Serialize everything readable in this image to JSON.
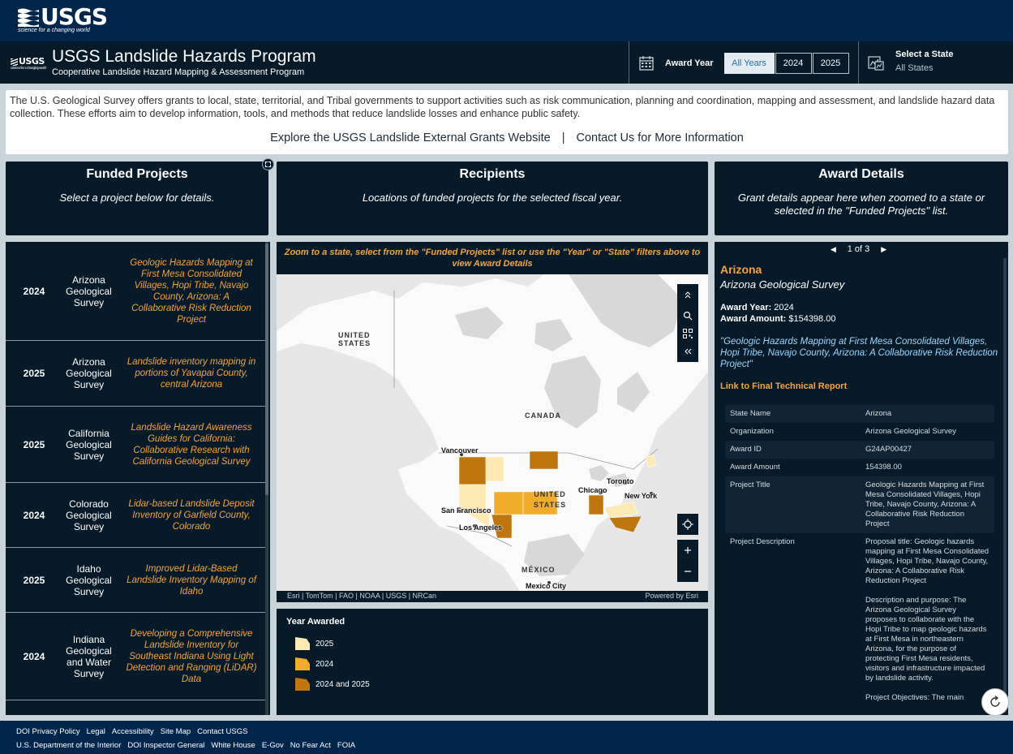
{
  "usgs_bar": {
    "logo_text": "USGS",
    "tagline": "science for a changing world"
  },
  "header": {
    "small_logo": "USGS",
    "small_tagline": "science for a changing world",
    "title": "USGS Landslide Hazards Program",
    "subtitle": "Cooperative Landslide Hazard Mapping & Assessment Program",
    "award_year_label": "Award Year",
    "year_buttons": [
      "All Years",
      "2024",
      "2025"
    ],
    "selected_year": "All Years",
    "state_label": "Select a State",
    "state_value": "All States"
  },
  "intro": {
    "text": "The U.S. Geological Survey offers grants to local, state, territorial, and Tribal governments to support activities such as risk communication, planning and coordination, mapping and assessment, and landslide hazard data collection. These efforts aim to develop information, tools, and methods that reduce landslide losses and enhance public safety.",
    "link1": "Explore the USGS Landslide External Grants Website",
    "separator": "|",
    "link2": "Contact Us for More Information"
  },
  "panels": {
    "funded": {
      "title": "Funded Projects",
      "desc": "Select a project below for details."
    },
    "recipients": {
      "title": "Recipients",
      "desc": "Locations of funded projects for the selected fiscal year."
    },
    "award": {
      "title": "Award Details",
      "desc": "Grant details appear here when zoomed to a state or selected in the \"Funded Projects\" list."
    }
  },
  "projects": [
    {
      "year": "2024",
      "org": "Arizona Geological Survey",
      "title": "Geologic Hazards Mapping at First Mesa Consolidated Villages, Hopi Tribe, Navajo County, Arizona: A Collaborative Risk Reduction Project"
    },
    {
      "year": "2025",
      "org": "Arizona Geological Survey",
      "title": "Landslide inventory mapping in portions of Yavapai County, central Arizona"
    },
    {
      "year": "2025",
      "org": "California Geological Survey",
      "title": "Landslide Hazard Awareness Guides for California: Collaborative Research with California Geological Survey"
    },
    {
      "year": "2024",
      "org": "Colorado Geological Survey",
      "title": "Lidar-based Landslide Deposit Inventory of Garfield County, Colorado"
    },
    {
      "year": "2025",
      "org": "Idaho Geological Survey",
      "title": "Improved Lidar-Based Landslide Inventory Mapping of Idaho"
    },
    {
      "year": "2024",
      "org": "Indiana Geological and Water Survey",
      "title": "Developing a Comprehensive Landslide Inventory for Southeast Indiana Using Light Detection and Ranging (LiDAR) Data"
    }
  ],
  "map": {
    "note": "Zoom to a state, select from the \"Funded Projects\" list or use the \"Year\" or \"State\" filters above to view Award Details",
    "labels": {
      "united_states_ak": "UNITED STATES",
      "canada": "CANADA",
      "united_states": "UNITED STATES",
      "mexico": "MÉXICO"
    },
    "cities": [
      "Vancouver",
      "Toronto",
      "Chicago",
      "New York",
      "San Francisco",
      "Los Angeles",
      "Mexico City"
    ],
    "attribution": "Esri | TomTom | FAO | NOAA | USGS | NRCan",
    "powered": "Powered by Esri"
  },
  "legend": {
    "title": "Year Awarded",
    "items": [
      {
        "label": "2025",
        "color": "#fde9b4"
      },
      {
        "label": "2024",
        "color": "#f0ad2c"
      },
      {
        "label": "2024 and 2025",
        "color": "#c0760e"
      }
    ]
  },
  "detail": {
    "pager": "1 of 3",
    "state": "Arizona",
    "org": "Arizona Geological Survey",
    "award_year_label": "Award Year:",
    "award_year": "2024",
    "award_amount_label": "Award Amount:",
    "award_amount": "$154398.00",
    "project_quote": "\"Geologic Hazards Mapping at First Mesa Consolidated Villages, Hopi Tribe, Navajo County, Arizona: A Collaborative Risk Reduction Project\"",
    "report_link": "Link to Final Technical Report",
    "table": [
      {
        "k": "State Name",
        "v": "Arizona"
      },
      {
        "k": "Organization",
        "v": "Arizona Geological Survey"
      },
      {
        "k": "Award ID",
        "v": "G24AP00427"
      },
      {
        "k": "Award Amount",
        "v": "154398.00"
      },
      {
        "k": "Project Title",
        "v": "Geologic Hazards Mapping at First Mesa Consolidated Villages, Hopi Tribe, Navajo County, Arizona: A Collaborative Risk Reduction Project"
      },
      {
        "k": "Project Description",
        "v": "Proposal title: Geologic hazards mapping at First Mesa Consolidated Villages, Hopi Tribe, Navajo County, Arizona: A Collaborative Risk Reduction Project\n\nDescription and purpose: The Arizona Geological Survey proposes to collaborate with the Hopi Tribe to map geologic hazards at First Mesa in northeastern Arizona, for the purpose of protecting First Mesa residents, visitors and infrastructure impacted by landslide activity.\n\nProject Objectives: The main"
      }
    ]
  },
  "footer": {
    "row1": [
      "DOI Privacy Policy",
      "Legal",
      "Accessibility",
      "Site Map",
      "Contact USGS"
    ],
    "row2": [
      "U.S. Department of the Interior",
      "DOI Inspector General",
      "White House",
      "E-Gov",
      "No Fear Act",
      "FOIA"
    ]
  }
}
